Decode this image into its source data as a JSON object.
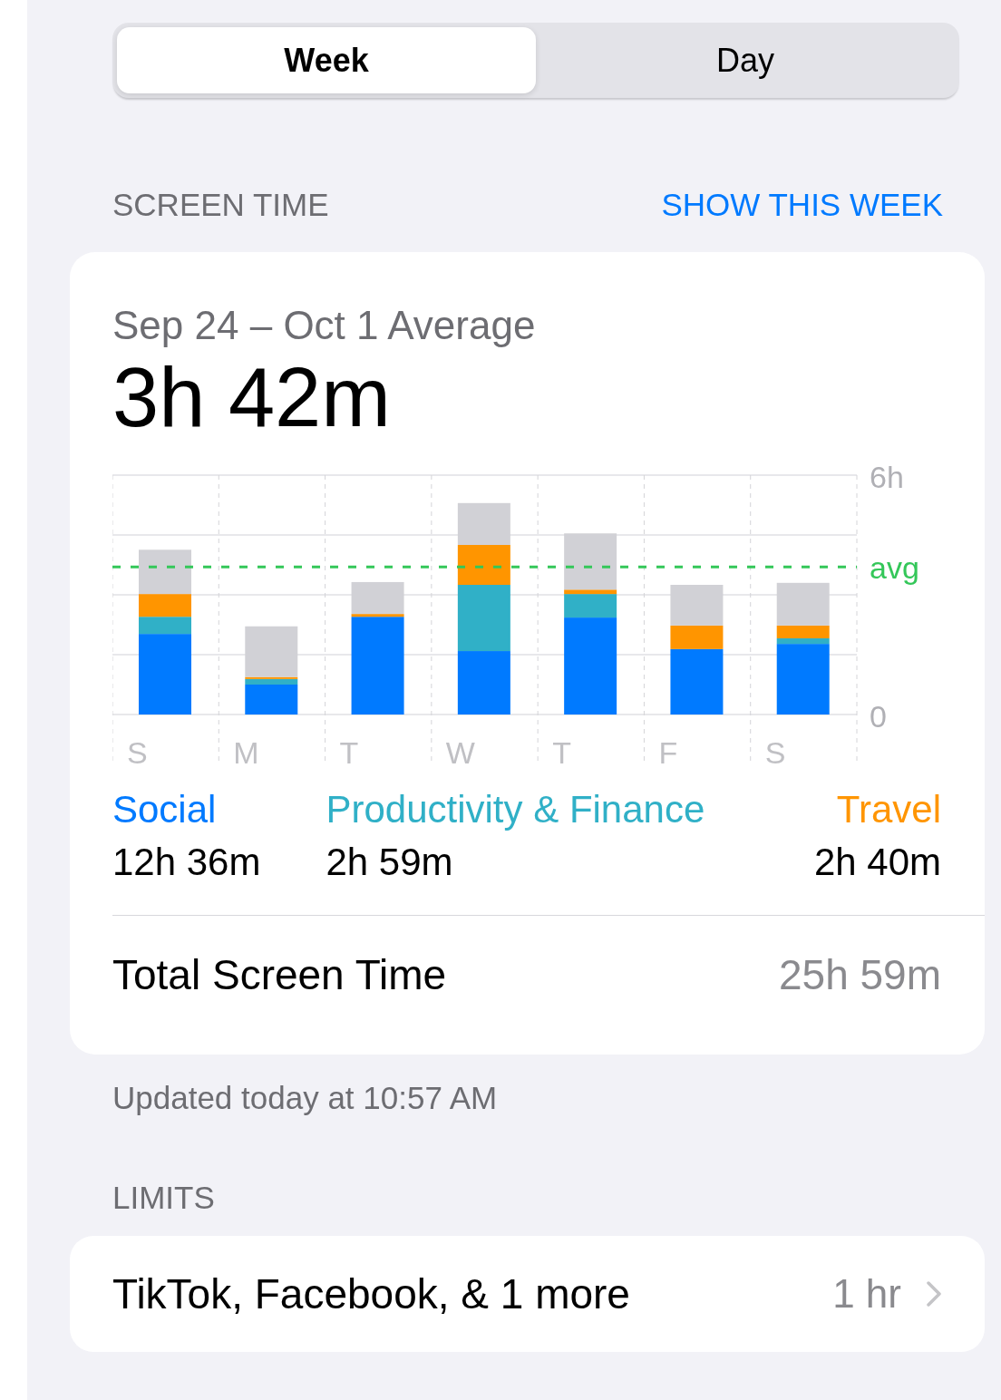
{
  "segments": [
    {
      "label": "Week",
      "selected": true
    },
    {
      "label": "Day",
      "selected": false
    }
  ],
  "screen_time": {
    "header": "SCREEN TIME",
    "action": "SHOW THIS WEEK",
    "period": "Sep 24 – Oct 1 Average",
    "average": "3h 42m",
    "chart_data": {
      "type": "bar",
      "stacked": true,
      "categories": [
        "S",
        "M",
        "T",
        "W",
        "T",
        "F",
        "S"
      ],
      "ylim": [
        0,
        6
      ],
      "yticks": [
        0,
        {
          "value": 6,
          "label": "6h"
        }
      ],
      "series": [
        {
          "name": "Social",
          "color": "#007aff",
          "values": [
            2.02,
            0.75,
            2.45,
            1.59,
            2.43,
            1.64,
            1.77
          ]
        },
        {
          "name": "Productivity & Finance",
          "color": "#30b0c7",
          "values": [
            0.43,
            0.14,
            0,
            1.66,
            0.59,
            0,
            0.14
          ]
        },
        {
          "name": "Travel",
          "color": "#ff9500",
          "values": [
            0.57,
            0.05,
            0.07,
            1.0,
            0.11,
            0.59,
            0.32
          ]
        },
        {
          "color": "#d1d1d6",
          "values": [
            1.11,
            1.27,
            0.8,
            1.05,
            1.41,
            1.02,
            1.07
          ]
        }
      ],
      "ref_lines": [
        {
          "axis": "y",
          "value": 3.7,
          "label": "avg",
          "color": "#34c759"
        }
      ]
    },
    "legend_values": [
      "12h 36m",
      "2h 59m",
      "2h 40m"
    ],
    "total": {
      "label": "Total Screen Time",
      "value": "25h 59m"
    },
    "footer": "Updated today at 10:57 AM"
  },
  "limits": {
    "header": "LIMITS",
    "item": {
      "label": "TikTok, Facebook, & 1 more",
      "value": "1 hr"
    }
  }
}
